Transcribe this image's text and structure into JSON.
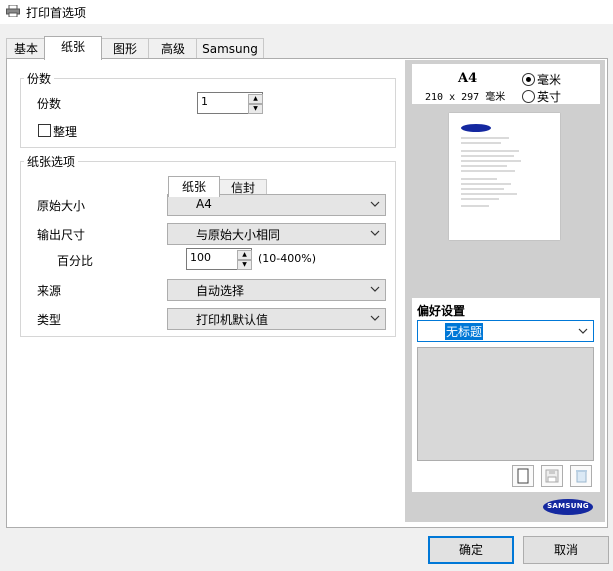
{
  "window": {
    "title": "打印首选项"
  },
  "tabs": [
    {
      "label": "基本",
      "active": false
    },
    {
      "label": "纸张",
      "active": true
    },
    {
      "label": "图形",
      "active": false
    },
    {
      "label": "高级",
      "active": false
    },
    {
      "label": "Samsung",
      "active": false
    }
  ],
  "copies_group": {
    "legend": "份数",
    "copies_label": "份数",
    "copies_value": "1",
    "collate_label": "整理",
    "collate_checked": false
  },
  "paper_group": {
    "legend": "纸张选项",
    "subtabs": [
      {
        "label": "纸张",
        "active": true
      },
      {
        "label": "信封",
        "active": false
      }
    ],
    "original_size": {
      "label": "原始大小",
      "value": "A4"
    },
    "output_size": {
      "label": "输出尺寸",
      "value": "与原始大小相同"
    },
    "percent": {
      "label": "百分比",
      "value": "100",
      "range": "(10-400%)"
    },
    "source": {
      "label": "来源",
      "value": "自动选择"
    },
    "type": {
      "label": "类型",
      "value": "打印机默认值"
    }
  },
  "preview": {
    "paper_name": "A4",
    "paper_dims": "210 x 297 毫米",
    "unit_mm": "毫米",
    "unit_inch": "英寸",
    "selected_unit": "mm"
  },
  "preferences": {
    "label": "偏好设置",
    "selected": "无标题"
  },
  "brand": "SAMSUNG",
  "buttons": {
    "ok": "确定",
    "cancel": "取消"
  },
  "colors": {
    "accent": "#0078d7",
    "samsung_blue": "#1428a0"
  }
}
